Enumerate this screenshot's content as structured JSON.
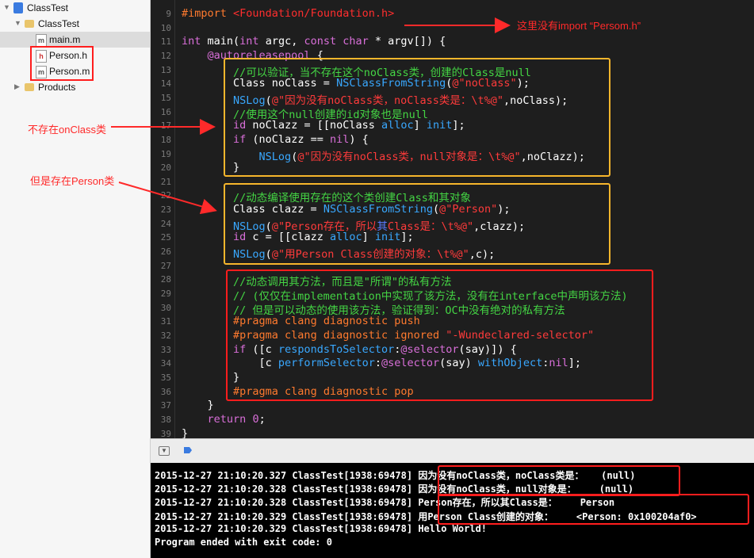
{
  "sidebar": {
    "project": "ClassTest",
    "group": "ClassTest",
    "files": [
      "main.m",
      "Person.h",
      "Person.m"
    ],
    "products": "Products"
  },
  "line_numbers": [
    "9",
    "10",
    "11",
    "12",
    "13",
    "14",
    "15",
    "16",
    "17",
    "18",
    "19",
    "20",
    "21",
    "22",
    "23",
    "24",
    "25",
    "26",
    "27",
    "28",
    "29",
    "30",
    "31",
    "32",
    "33",
    "34",
    "35",
    "36",
    "37",
    "38",
    "39"
  ],
  "code": [
    {
      "ln": "9",
      "spans": [
        {
          "t": "#import ",
          "c": "#ff7a2e"
        },
        {
          "t": "<Foundation/Foundation.h>",
          "c": "#ff2e2e"
        }
      ]
    },
    {
      "ln": "10",
      "spans": []
    },
    {
      "ln": "11",
      "spans": [
        {
          "t": "int",
          "c": "#d96fd9"
        },
        {
          "t": " main(",
          "c": "#ffffff"
        },
        {
          "t": "int",
          "c": "#d96fd9"
        },
        {
          "t": " argc, ",
          "c": "#ffffff"
        },
        {
          "t": "const char",
          "c": "#d96fd9"
        },
        {
          "t": " * argv[]) {",
          "c": "#ffffff"
        }
      ]
    },
    {
      "ln": "12",
      "spans": [
        {
          "t": "    "
        },
        {
          "t": "@autoreleasepool",
          "c": "#d96fd9"
        },
        {
          "t": " {",
          "c": "#ffffff"
        }
      ]
    },
    {
      "ln": "13",
      "spans": [
        {
          "t": "        "
        },
        {
          "t": "//可以验证，当不存在这个noClass类，创建的Class是null",
          "c": "#44d544"
        }
      ]
    },
    {
      "ln": "14",
      "spans": [
        {
          "t": "        Class noClass = ",
          "c": "#ffffff"
        },
        {
          "t": "NSClassFromString",
          "c": "#39a8ff"
        },
        {
          "t": "(",
          "c": "#ffffff"
        },
        {
          "t": "@\"noClass\"",
          "c": "#ff3b3b"
        },
        {
          "t": ");",
          "c": "#ffffff"
        }
      ]
    },
    {
      "ln": "15",
      "spans": [
        {
          "t": "        "
        },
        {
          "t": "NSLog",
          "c": "#39a8ff"
        },
        {
          "t": "(",
          "c": "#ffffff"
        },
        {
          "t": "@\"因为没有noClass类，noClass类是：\\t%@\"",
          "c": "#ff3b3b"
        },
        {
          "t": ",noClass);",
          "c": "#ffffff"
        }
      ]
    },
    {
      "ln": "16",
      "spans": [
        {
          "t": "        "
        },
        {
          "t": "//使用这个null创建的id对象也是null",
          "c": "#44d544"
        }
      ]
    },
    {
      "ln": "17",
      "spans": [
        {
          "t": "        "
        },
        {
          "t": "id",
          "c": "#d96fd9"
        },
        {
          "t": " noClazz = [[noClass ",
          "c": "#ffffff"
        },
        {
          "t": "alloc",
          "c": "#39a8ff"
        },
        {
          "t": "] ",
          "c": "#ffffff"
        },
        {
          "t": "init",
          "c": "#39a8ff"
        },
        {
          "t": "];",
          "c": "#ffffff"
        }
      ]
    },
    {
      "ln": "18",
      "spans": [
        {
          "t": "        "
        },
        {
          "t": "if",
          "c": "#d96fd9"
        },
        {
          "t": " (noClazz == ",
          "c": "#ffffff"
        },
        {
          "t": "nil",
          "c": "#d96fd9"
        },
        {
          "t": ") {",
          "c": "#ffffff"
        }
      ]
    },
    {
      "ln": "19",
      "spans": [
        {
          "t": "            "
        },
        {
          "t": "NSLog",
          "c": "#39a8ff"
        },
        {
          "t": "(",
          "c": "#ffffff"
        },
        {
          "t": "@\"因为没有noClass类，null对象是：\\t%@\"",
          "c": "#ff3b3b"
        },
        {
          "t": ",noClazz);",
          "c": "#ffffff"
        }
      ]
    },
    {
      "ln": "20",
      "spans": [
        {
          "t": "        }",
          "c": "#ffffff"
        }
      ]
    },
    {
      "ln": "21",
      "spans": []
    },
    {
      "ln": "22",
      "spans": [
        {
          "t": "        "
        },
        {
          "t": "//动态编译使用存在的这个类创建Class和其对象",
          "c": "#44d544"
        }
      ]
    },
    {
      "ln": "23",
      "spans": [
        {
          "t": "        Class clazz = ",
          "c": "#ffffff"
        },
        {
          "t": "NSClassFromString",
          "c": "#39a8ff"
        },
        {
          "t": "(",
          "c": "#ffffff"
        },
        {
          "t": "@\"Person\"",
          "c": "#ff3b3b"
        },
        {
          "t": ");",
          "c": "#ffffff"
        }
      ]
    },
    {
      "ln": "24",
      "spans": [
        {
          "t": "        "
        },
        {
          "t": "NSLog",
          "c": "#39a8ff"
        },
        {
          "t": "(",
          "c": "#ffffff"
        },
        {
          "t": "@\"Person存在，所以",
          "c": "#ff3b3b"
        },
        {
          "t": "其",
          "c": "#5a7bff"
        },
        {
          "t": "Class是：\\t%@\"",
          "c": "#ff3b3b"
        },
        {
          "t": ",clazz);",
          "c": "#ffffff"
        }
      ]
    },
    {
      "ln": "25",
      "spans": [
        {
          "t": "        "
        },
        {
          "t": "id",
          "c": "#d96fd9"
        },
        {
          "t": " c = [[clazz ",
          "c": "#ffffff"
        },
        {
          "t": "alloc",
          "c": "#39a8ff"
        },
        {
          "t": "] ",
          "c": "#ffffff"
        },
        {
          "t": "init",
          "c": "#39a8ff"
        },
        {
          "t": "];",
          "c": "#ffffff"
        }
      ]
    },
    {
      "ln": "26",
      "spans": [
        {
          "t": "        "
        },
        {
          "t": "NSLog",
          "c": "#39a8ff"
        },
        {
          "t": "(",
          "c": "#ffffff"
        },
        {
          "t": "@\"用Person Class创建的对象：\\t%@\"",
          "c": "#ff3b3b"
        },
        {
          "t": ",c);",
          "c": "#ffffff"
        }
      ]
    },
    {
      "ln": "27",
      "spans": []
    },
    {
      "ln": "28",
      "spans": [
        {
          "t": "        "
        },
        {
          "t": "//动态调用其方法，而且是\"所谓\"的私有方法",
          "c": "#44d544"
        }
      ]
    },
    {
      "ln": "29",
      "spans": [
        {
          "t": "        "
        },
        {
          "t": "// (仅仅在implementation中实现了该方法，没有在interface中声明该方法)",
          "c": "#44d544"
        }
      ]
    },
    {
      "ln": "30",
      "spans": [
        {
          "t": "        "
        },
        {
          "t": "// 但是可以动态的使用该方法，验证得到：OC中没有绝对的私有方法",
          "c": "#44d544"
        }
      ]
    },
    {
      "ln": "31",
      "spans": [
        {
          "t": "        "
        },
        {
          "t": "#pragma clang diagnostic push",
          "c": "#ff7a2e"
        }
      ]
    },
    {
      "ln": "32",
      "spans": [
        {
          "t": "        "
        },
        {
          "t": "#pragma clang diagnostic ignored ",
          "c": "#ff7a2e"
        },
        {
          "t": "\"-Wundeclared-selector\"",
          "c": "#ff3b3b"
        }
      ]
    },
    {
      "ln": "33",
      "spans": [
        {
          "t": "        "
        },
        {
          "t": "if",
          "c": "#d96fd9"
        },
        {
          "t": " ([c ",
          "c": "#ffffff"
        },
        {
          "t": "respondsToSelector",
          "c": "#39a8ff"
        },
        {
          "t": ":",
          "c": "#ffffff"
        },
        {
          "t": "@selector",
          "c": "#d96fd9"
        },
        {
          "t": "(say)]) {",
          "c": "#ffffff"
        }
      ]
    },
    {
      "ln": "34",
      "spans": [
        {
          "t": "            [c ",
          "c": "#ffffff"
        },
        {
          "t": "performSelector",
          "c": "#39a8ff"
        },
        {
          "t": ":",
          "c": "#ffffff"
        },
        {
          "t": "@selector",
          "c": "#d96fd9"
        },
        {
          "t": "(say) ",
          "c": "#ffffff"
        },
        {
          "t": "withObject",
          "c": "#39a8ff"
        },
        {
          "t": ":",
          "c": "#ffffff"
        },
        {
          "t": "nil",
          "c": "#d96fd9"
        },
        {
          "t": "];",
          "c": "#ffffff"
        }
      ]
    },
    {
      "ln": "35",
      "spans": [
        {
          "t": "        }",
          "c": "#ffffff"
        }
      ]
    },
    {
      "ln": "36",
      "spans": [
        {
          "t": "        "
        },
        {
          "t": "#pragma clang diagnostic pop",
          "c": "#ff7a2e"
        }
      ]
    },
    {
      "ln": "37",
      "spans": [
        {
          "t": "    }",
          "c": "#ffffff"
        }
      ]
    },
    {
      "ln": "38",
      "spans": [
        {
          "t": "    "
        },
        {
          "t": "return",
          "c": "#d96fd9"
        },
        {
          "t": " ",
          "c": "#ffffff"
        },
        {
          "t": "0",
          "c": "#d96fd9"
        },
        {
          "t": ";",
          "c": "#ffffff"
        }
      ]
    },
    {
      "ln": "39",
      "spans": [
        {
          "t": "}",
          "c": "#ffffff"
        }
      ]
    }
  ],
  "annotations": {
    "no_import": "这里没有import “Persom.h”",
    "no_class": "不存在onClass类",
    "has_person": "但是存在Person类"
  },
  "console": [
    "2015-12-27 21:10:20.327 ClassTest[1938:69478] 因为没有noClass类，noClass类是：   (null)",
    "2015-12-27 21:10:20.328 ClassTest[1938:69478] 因为没有noClass类，null对象是：    (null)",
    "2015-12-27 21:10:20.328 ClassTest[1938:69478] Person存在，所以其Class是：    Person",
    "2015-12-27 21:10:20.329 ClassTest[1938:69478] 用Person Class创建的对象：    <Person: 0x100204af0>",
    "2015-12-27 21:10:20.329 ClassTest[1938:69478] Hello World!",
    "Program ended with exit code: 0"
  ],
  "colors": {
    "comment": "#44d544",
    "keyword": "#d96fd9",
    "function": "#39a8ff",
    "string": "#ff3b3b",
    "preprocessor": "#ff7a2e",
    "annotation": "#ff2a2a",
    "yellow_box": "#f7b62c"
  }
}
